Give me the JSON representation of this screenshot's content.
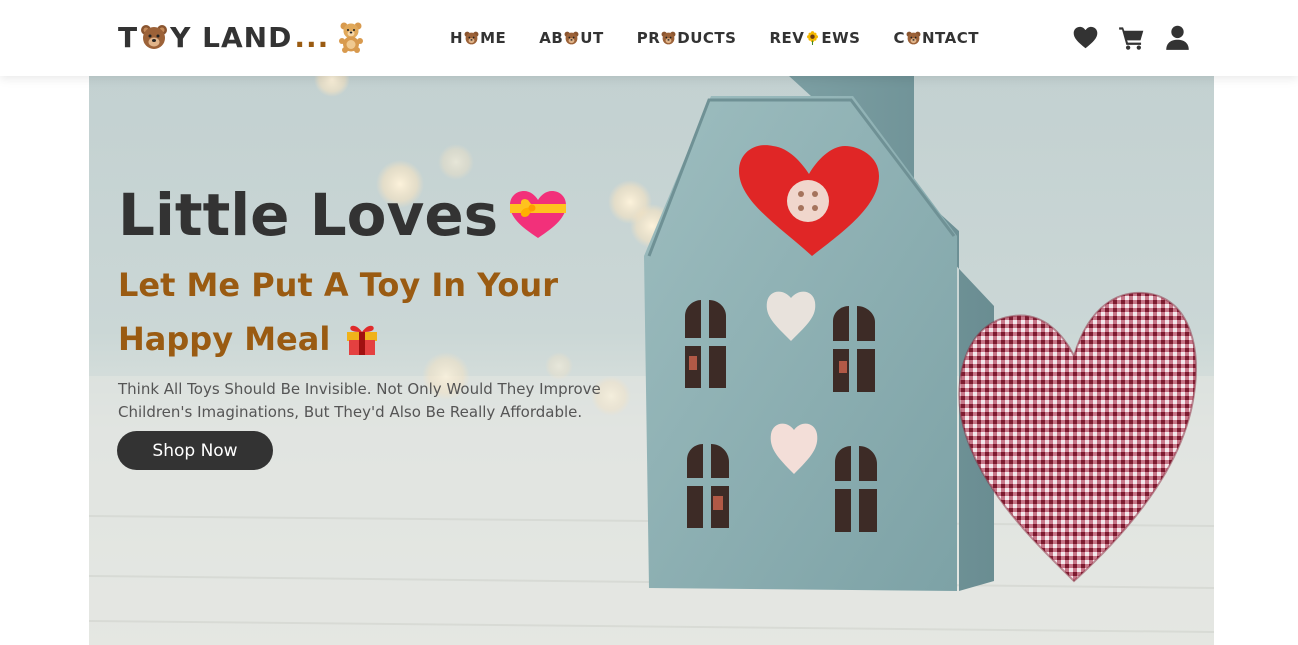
{
  "logo": {
    "letter_t": "T",
    "rest": "Y LAND",
    "dots": "...",
    "icon_left": "bear-face-icon",
    "icon_right": "teddy-bear-icon"
  },
  "nav": [
    {
      "before": "H",
      "icon": "bear-face-icon",
      "after": "ME"
    },
    {
      "before": "AB",
      "icon": "bear-face-icon",
      "after": "UT"
    },
    {
      "before": "PR",
      "icon": "bear-face-icon",
      "after": "DUCTS"
    },
    {
      "before": "REV",
      "icon": "sunflower-icon",
      "after": "EWS"
    },
    {
      "before": "C",
      "icon": "bear-face-icon",
      "after": "NTACT"
    }
  ],
  "header_icons": [
    "heart-icon",
    "cart-icon",
    "user-icon"
  ],
  "hero": {
    "title": "Little Loves",
    "title_icon": "heart-with-ribbon-icon",
    "subtitle": "Let Me Put A Toy In Your Happy Meal",
    "subtitle_icon": "gift-icon",
    "description": "Think All Toys Should Be Invisible. Not Only Would They Improve Children's Imaginations, But They'd Also Be Really Affordable.",
    "cta_label": "Shop Now"
  },
  "colors": {
    "dark_text": "#333333",
    "accent_brown": "#9a5b12",
    "button_bg": "#333333",
    "button_text": "#ffffff",
    "house_blue": "#8fb1b4",
    "felt_red": "#e02626",
    "gingham_red": "#a0283c"
  }
}
